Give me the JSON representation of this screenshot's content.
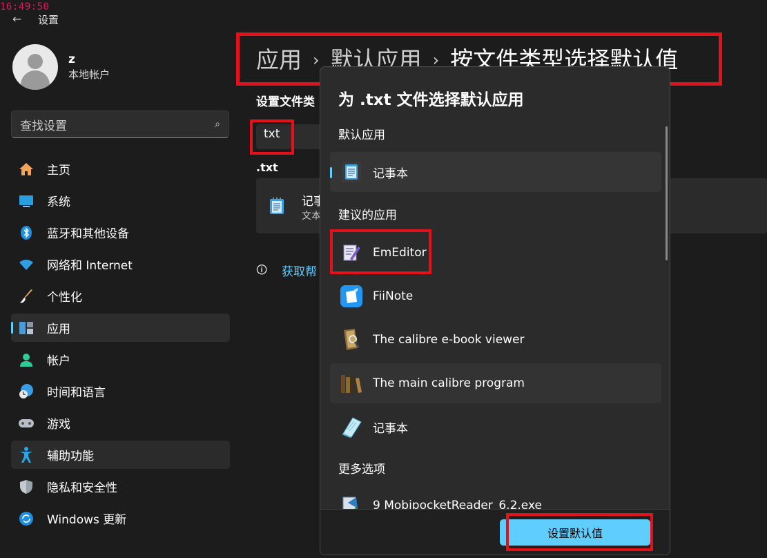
{
  "clock": "16:49:50",
  "window": {
    "title": "设置"
  },
  "user": {
    "name": "z",
    "account_type": "本地帐户"
  },
  "search": {
    "placeholder": "查找设置"
  },
  "nav": {
    "items": [
      {
        "label": "主页",
        "icon": "home-icon"
      },
      {
        "label": "系统",
        "icon": "display-icon"
      },
      {
        "label": "蓝牙和其他设备",
        "icon": "bluetooth-icon"
      },
      {
        "label": "网络和 Internet",
        "icon": "wifi-icon"
      },
      {
        "label": "个性化",
        "icon": "brush-icon"
      },
      {
        "label": "应用",
        "icon": "apps-icon",
        "selected": true
      },
      {
        "label": "帐户",
        "icon": "account-icon"
      },
      {
        "label": "时间和语言",
        "icon": "globe-clock-icon"
      },
      {
        "label": "游戏",
        "icon": "gamepad-icon"
      },
      {
        "label": "辅助功能",
        "icon": "accessibility-icon",
        "hover": true
      },
      {
        "label": "隐私和安全性",
        "icon": "shield-icon"
      },
      {
        "label": "Windows 更新",
        "icon": "update-icon"
      }
    ]
  },
  "breadcrumb": {
    "parent": "应用",
    "middle": "默认应用",
    "current": "按文件类型选择默认值",
    "separator": "›"
  },
  "main": {
    "section_label": "设置文件类",
    "extension_input_value": "txt",
    "extension_heading": ".txt",
    "current_app_name": "记事",
    "current_app_sub": "文本",
    "help_link": "获取帮"
  },
  "dialog": {
    "title": "为 .txt 文件选择默认应用",
    "default_section": "默认应用",
    "default_app": "记事本",
    "suggested_section": "建议的应用",
    "suggested_apps": [
      {
        "label": "EmEditor",
        "icon": "emeditor-icon"
      },
      {
        "label": "FiiNote",
        "icon": "fiinote-icon"
      },
      {
        "label": "The calibre e-book viewer",
        "icon": "calibre-viewer-icon"
      },
      {
        "label": "The main calibre program",
        "icon": "calibre-library-icon"
      },
      {
        "label": "记事本",
        "icon": "notepad-legacy-icon"
      }
    ],
    "more_section": "更多选项",
    "more_apps": [
      {
        "label": "9 MobipocketReader_6.2.exe",
        "icon": "exe-icon"
      }
    ],
    "set_default_button": "设置默认值"
  },
  "colors": {
    "accent": "#60cdff",
    "highlight_box": "#e4101a",
    "background": "#1c1c1c",
    "dialog": "#2b2b2b"
  }
}
